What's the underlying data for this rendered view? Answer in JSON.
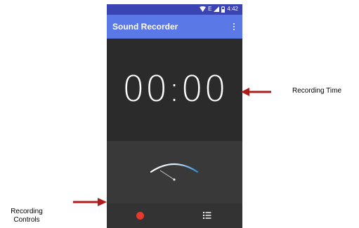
{
  "status_bar": {
    "time": "4:42",
    "network_label": "E"
  },
  "app_bar": {
    "title": "Sound Recorder"
  },
  "timer": {
    "value": "00:00"
  },
  "annotations": {
    "recording_time": "Recording Time",
    "recording_controls": "Recording Controls"
  },
  "colors": {
    "status_bar": "#3a45b3",
    "app_bar": "#5a78e6",
    "record": "#e8392e",
    "arrow": "#b01c1c"
  },
  "icons": [
    "wifi-icon",
    "signal-icon",
    "battery-icon",
    "overflow-menu-icon",
    "record-icon",
    "list-icon",
    "level-meter-icon"
  ]
}
